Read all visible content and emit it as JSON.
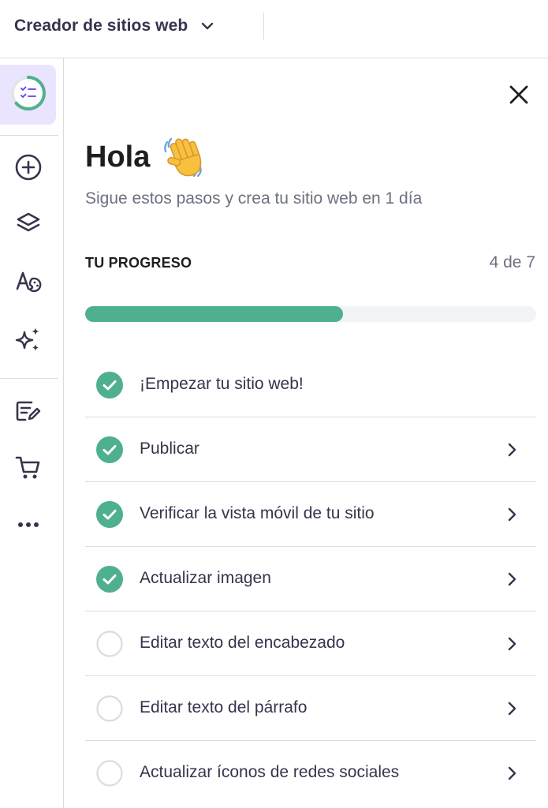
{
  "topbar": {
    "app_title": "Creador de sitios web",
    "app_menu_icon": "chevron-down-icon"
  },
  "sidebar": {
    "items": [
      {
        "name": "checklist-progress",
        "icon": "checklist-progress-icon",
        "active": true
      },
      {
        "name": "add",
        "icon": "plus-circle-icon"
      },
      {
        "name": "layers",
        "icon": "layers-icon"
      },
      {
        "name": "styles",
        "icon": "typography-palette-icon"
      },
      {
        "name": "ai-tools",
        "icon": "sparkles-icon"
      },
      {
        "name": "blog",
        "icon": "edit-text-icon"
      },
      {
        "name": "store",
        "icon": "shopping-cart-icon"
      },
      {
        "name": "more",
        "icon": "more-horizontal-icon"
      }
    ]
  },
  "panel": {
    "greeting": "Hola",
    "greeting_emoji": "waving-hand-icon",
    "subtitle": "Sigue estos pasos y crea tu sitio web en 1 día",
    "progress": {
      "label": "TU PROGRESO",
      "count_text": "4 de 7",
      "completed": 4,
      "total": 7
    },
    "tasks": [
      {
        "label": "¡Empezar tu sitio web!",
        "done": true,
        "has_arrow": false
      },
      {
        "label": "Publicar",
        "done": true,
        "has_arrow": true
      },
      {
        "label": "Verificar la vista móvil de tu sitio",
        "done": true,
        "has_arrow": true
      },
      {
        "label": "Actualizar imagen",
        "done": true,
        "has_arrow": true
      },
      {
        "label": "Editar texto del encabezado",
        "done": false,
        "has_arrow": true
      },
      {
        "label": "Editar texto del párrafo",
        "done": false,
        "has_arrow": true
      },
      {
        "label": "Actualizar íconos de redes sociales",
        "done": false,
        "has_arrow": true
      }
    ]
  },
  "colors": {
    "accent_purple": "#673de6",
    "active_bg": "#ebe4ff",
    "success_green": "#4fb08f",
    "text_dark": "#1d1e20",
    "text_muted": "#6d7081"
  }
}
